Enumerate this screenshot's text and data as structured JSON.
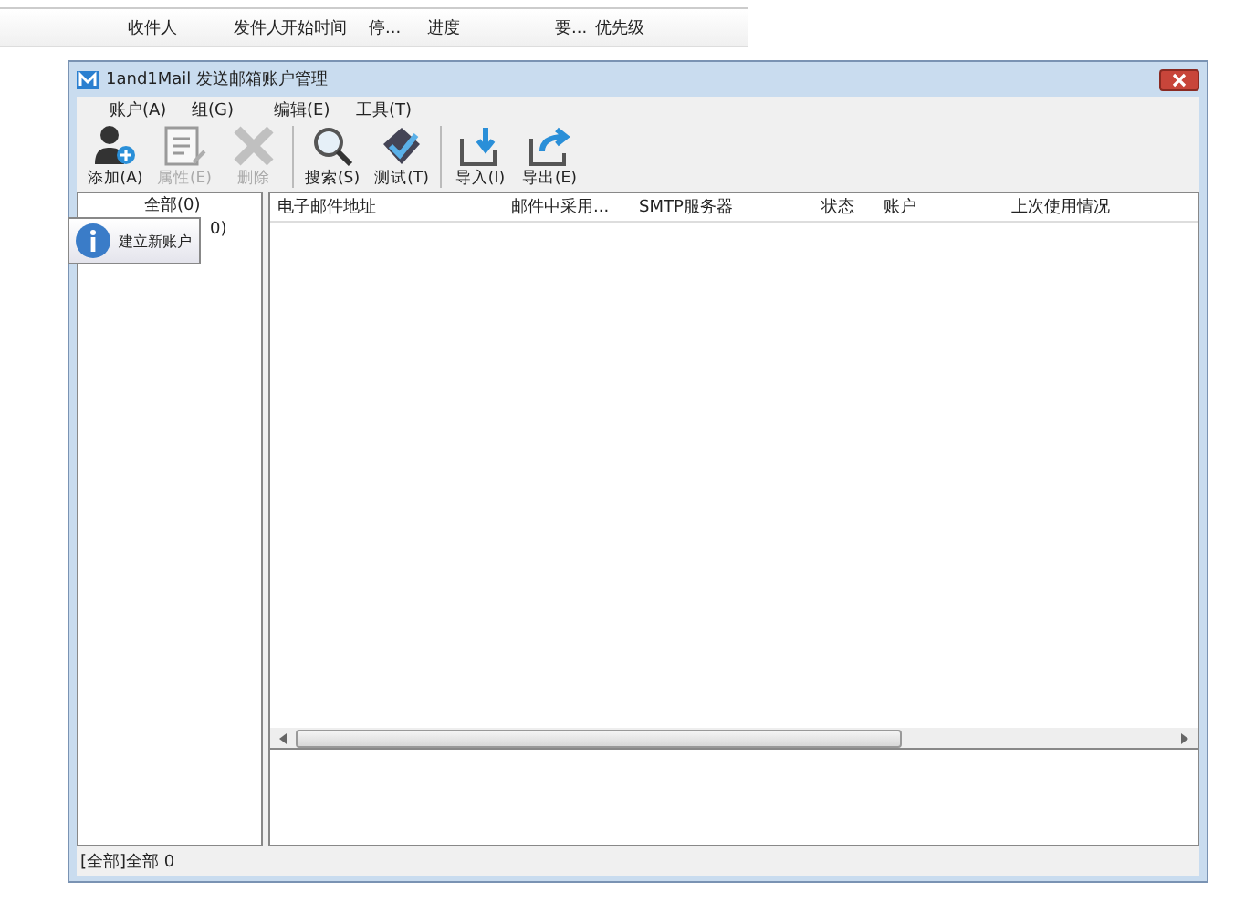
{
  "background_table": {
    "columns": [
      "收件人",
      "发件人",
      "开始时间",
      "停...",
      "进度",
      "要...",
      "优先级"
    ]
  },
  "window": {
    "title": "1and1Mail 发送邮箱账户管理"
  },
  "menu": [
    "账户(A)",
    "组(G)",
    "编辑(E)",
    "工具(T)"
  ],
  "toolbar": [
    {
      "kind": "add",
      "label": "添加(A)",
      "disabled": false,
      "separator_before": false
    },
    {
      "kind": "properties",
      "label": "属性(E)",
      "disabled": true,
      "separator_before": false
    },
    {
      "kind": "delete",
      "label": "删除",
      "disabled": true,
      "separator_before": false
    },
    {
      "kind": "search",
      "label": "搜索(S)",
      "disabled": false,
      "separator_before": true
    },
    {
      "kind": "test",
      "label": "测试(T)",
      "disabled": false,
      "separator_before": false
    },
    {
      "kind": "import",
      "label": "导入(I)",
      "disabled": false,
      "separator_before": true
    },
    {
      "kind": "export",
      "label": "导出(E)",
      "disabled": false,
      "separator_before": false
    }
  ],
  "tree": [
    "全部(0)",
    "0)"
  ],
  "tooltip": "建立新账户",
  "table": {
    "columns": [
      "电子邮件地址",
      "邮件中采用...",
      "SMTP服务器",
      "状态",
      "账户",
      "上次使用情况"
    ]
  },
  "status_bar": "[全部]全部 0"
}
